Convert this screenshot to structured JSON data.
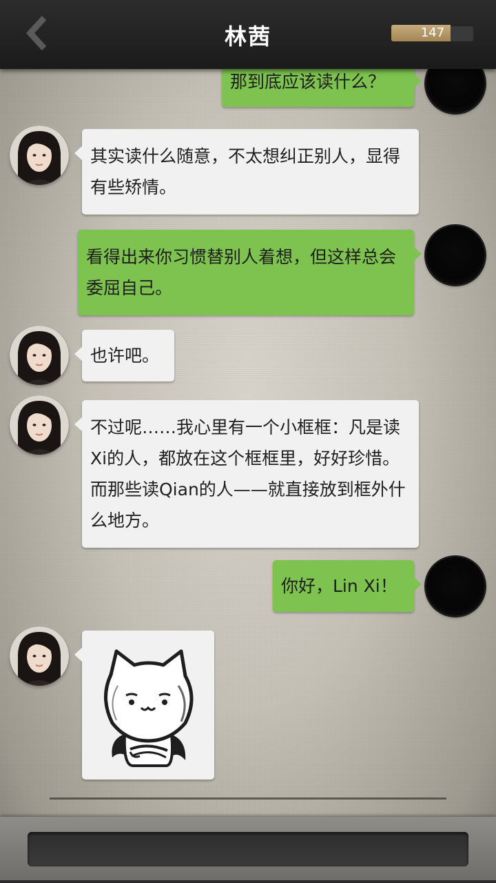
{
  "header": {
    "title": "林茜",
    "counter": "147",
    "counter_fill": 0.72
  },
  "messages": [
    {
      "side": "right",
      "text": "那到底应该读什么？"
    },
    {
      "side": "left",
      "text": "其实读什么随意，不太想纠正别人，显得有些矫情。"
    },
    {
      "side": "right",
      "text": "看得出来你习惯替别人着想，但这样总会委屈自己。"
    },
    {
      "side": "left",
      "text": "也许吧。"
    },
    {
      "side": "left",
      "text": "不过呢……我心里有一个小框框：凡是读Xi的人，都放在这个框框里，好好珍惜。而那些读Qian的人——就直接放到框外什么地方。"
    },
    {
      "side": "right",
      "text": "你好，Lin Xi！"
    },
    {
      "side": "left",
      "type": "sticker",
      "sticker": "white-cat-crossed-arms-sticker"
    }
  ],
  "colors": {
    "header_bg": "#1f1f1f",
    "bubble_self": "#7ec350",
    "bubble_other": "#f1f1f1",
    "counter_fill": "#b89a68"
  },
  "icons": {
    "back": "chevron-left-icon"
  }
}
